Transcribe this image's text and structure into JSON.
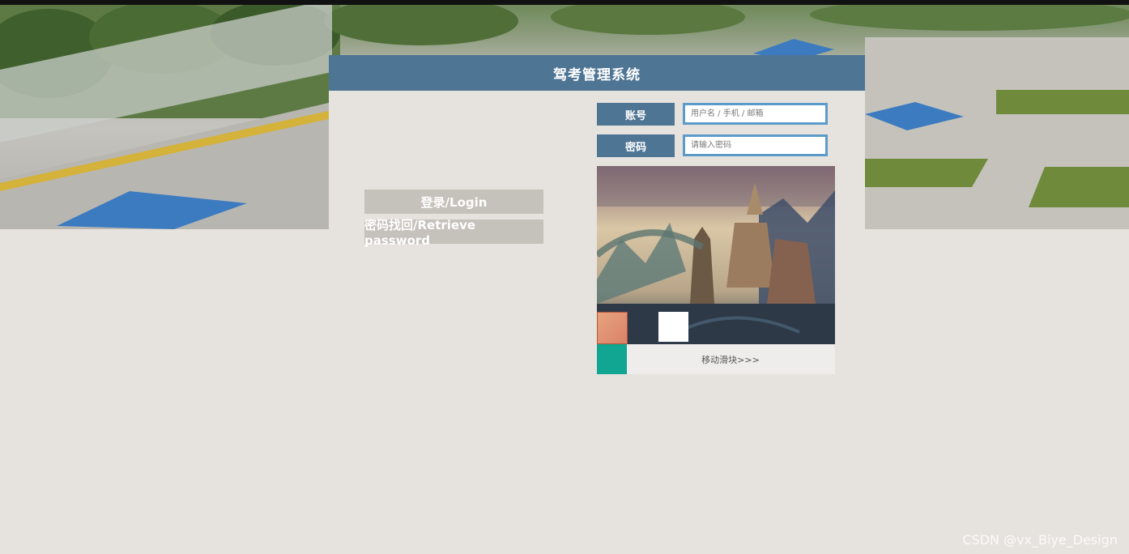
{
  "header": {
    "title": "驾考管理系统"
  },
  "side_buttons": {
    "login_label": "登录/Login",
    "retrieve_label": "密码找回/Retrieve password"
  },
  "form": {
    "account_label": "账号",
    "account_placeholder": "用户名 / 手机 / 邮箱",
    "password_label": "密码",
    "password_placeholder": "请输入密码"
  },
  "captcha": {
    "slider_hint": "移动滑块>>>"
  },
  "watermark": "CSDN @vx_Biye_Design",
  "colors": {
    "accent": "#4f7594",
    "background": "#e6e3de",
    "button": "#c5c1bb",
    "input_border": "#5b9ac9",
    "slider_handle": "#11a692"
  }
}
